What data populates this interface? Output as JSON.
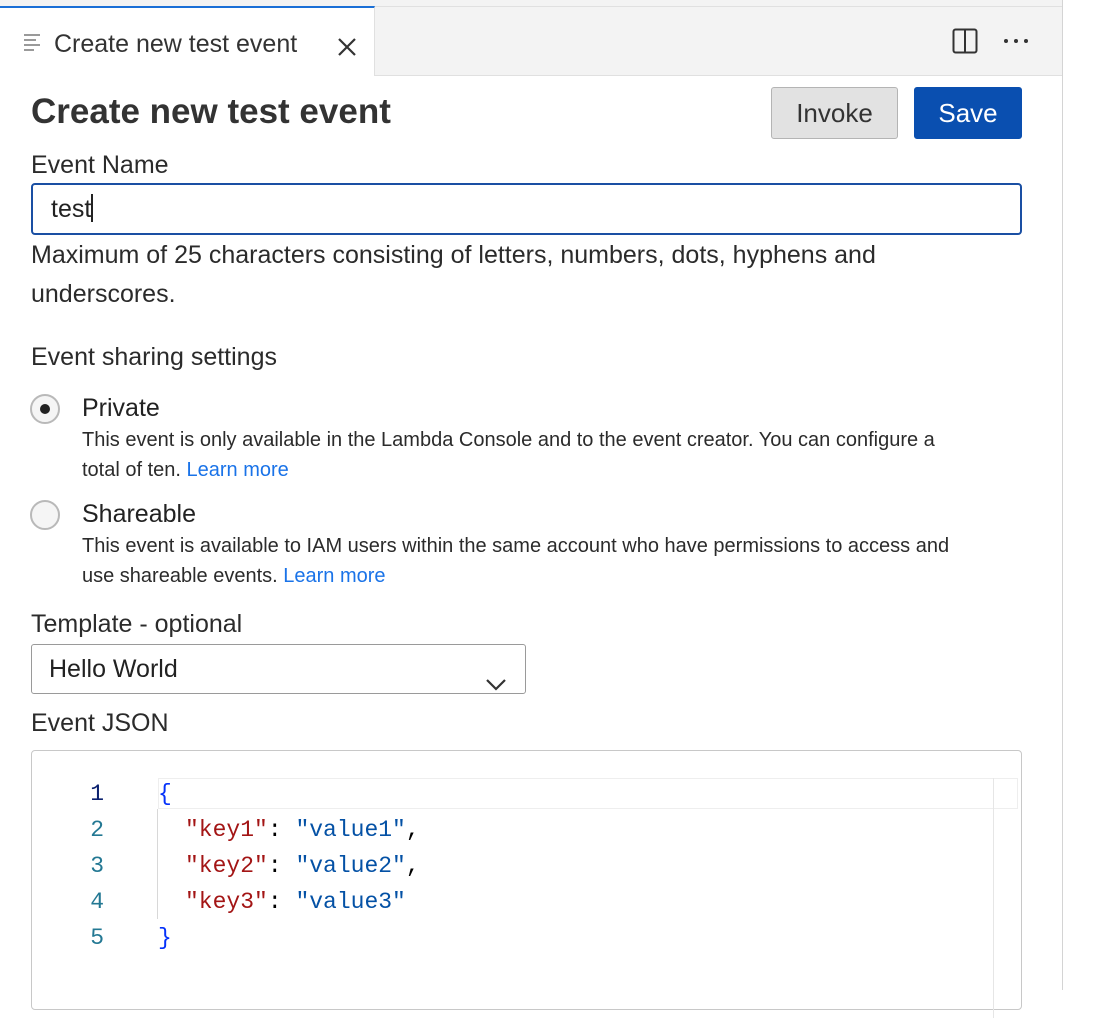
{
  "tab": {
    "label": "Create new test event"
  },
  "page": {
    "title": "Create new test event"
  },
  "buttons": {
    "invoke": "Invoke",
    "save": "Save"
  },
  "event_name": {
    "label": "Event Name",
    "value": "test",
    "help": "Maximum of 25 characters consisting of letters, numbers, dots, hyphens and underscores."
  },
  "sharing": {
    "label": "Event sharing settings",
    "options": [
      {
        "title": "Private",
        "desc": "This event is only available in the Lambda Console and to the event creator. You can configure a total of ten.",
        "link": "Learn more",
        "selected": true
      },
      {
        "title": "Shareable",
        "desc": "This event is available to IAM users within the same account who have permissions to access and use shareable events.",
        "link": "Learn more",
        "selected": false
      }
    ]
  },
  "template": {
    "label": "Template - optional",
    "selected": "Hello World"
  },
  "event_json": {
    "label": "Event JSON",
    "lines": [
      {
        "num": "1",
        "text": "{"
      },
      {
        "num": "2",
        "key": "\"key1\"",
        "sep": ": ",
        "value": "\"value1\"",
        "end": ","
      },
      {
        "num": "3",
        "key": "\"key2\"",
        "sep": ": ",
        "value": "\"value2\"",
        "end": ","
      },
      {
        "num": "4",
        "key": "\"key3\"",
        "sep": ": ",
        "value": "\"value3\"",
        "end": ""
      },
      {
        "num": "5",
        "text": "}"
      }
    ]
  },
  "icons": {
    "tab": "lines-icon",
    "close": "close-icon",
    "split": "split-editor-icon",
    "more": "more-icon",
    "select": "chevron-down-icon"
  },
  "colors": {
    "accent": "#0a4fb0",
    "link": "#1a73e8",
    "json_key": "#a31515",
    "json_value": "#0451a5",
    "json_brace": "#0431fa"
  }
}
